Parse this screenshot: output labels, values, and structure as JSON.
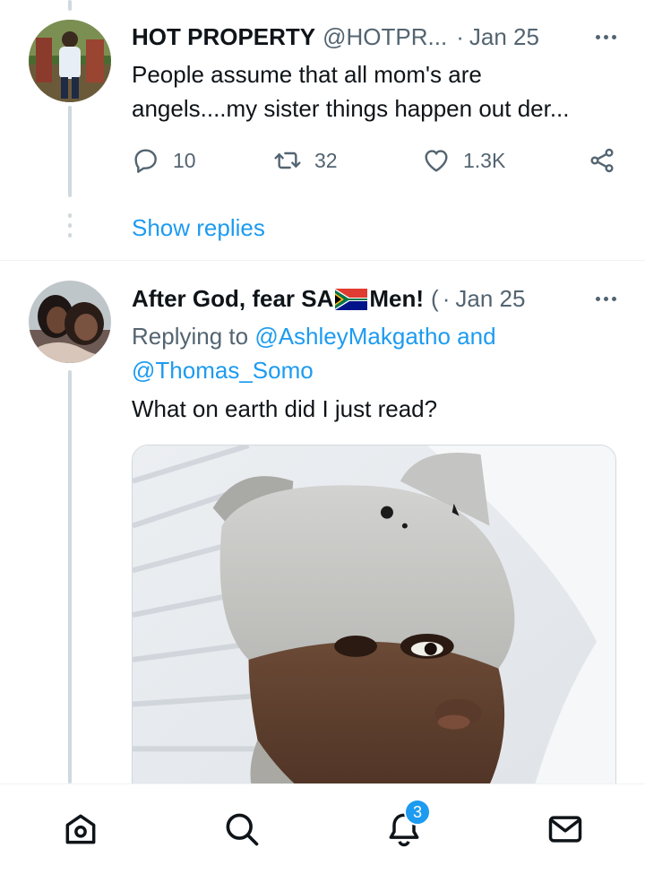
{
  "tweets": [
    {
      "display_name": "HOT PROPERTY",
      "handle": "@HOTPR...",
      "separator": "·",
      "date": "Jan 25",
      "text_line1": "People assume that all mom's are",
      "text_line2": "angels....my sister things happen out der...",
      "actions": {
        "replies": "10",
        "retweets": "32",
        "likes": "1.3K"
      },
      "show_replies": "Show replies"
    },
    {
      "display_name_part1": "After God, fear SA",
      "display_name_part2": "Men!",
      "handle": "(",
      "separator": "·",
      "date": "Jan 25",
      "replying_to_label": "Replying to",
      "mention1": "@AshleyMakgatho",
      "and": "and",
      "mention2": "@Thomas_Somo",
      "text": "What on earth did I just read?"
    }
  ],
  "tabbar": {
    "items": [
      "home-icon",
      "search-icon",
      "notifications-icon",
      "messages-icon"
    ],
    "notification_count": "3"
  },
  "colors": {
    "accent": "#1d9bf0",
    "secondary_text": "#536471",
    "primary_text": "#0f1419",
    "thread_line": "#cfd9de"
  }
}
